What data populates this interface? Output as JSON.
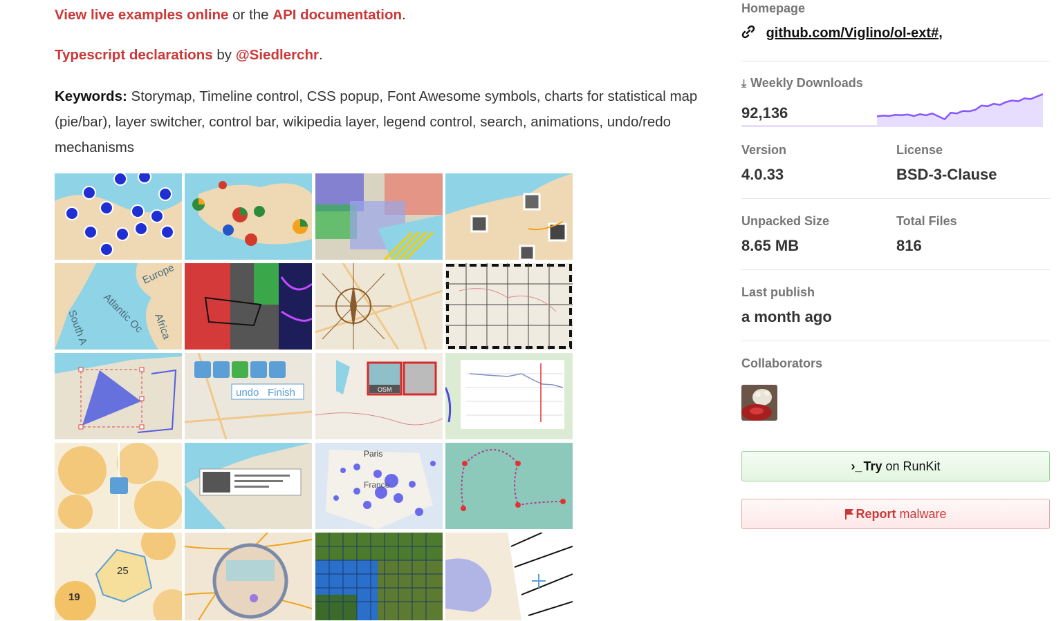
{
  "readme": {
    "live_examples_link": "View live examples online",
    "or_the_text": "or the",
    "api_docs_link": "API documentation",
    "period1": ".",
    "typescript_link": "Typescript declarations",
    "by_text": "by",
    "author_link": "@Siedlerchr",
    "period2": ".",
    "keywords_label": "Keywords:",
    "keywords_text": "Storymap, Timeline control, CSS popup, Font Awesome symbols, charts for statistical map (pie/bar), layer switcher, control bar, wikipedia layer, legend control, search, animations, undo/redo mechanisms",
    "tile_labels": {
      "europe": "Europe",
      "atlantic": "Atlantic Oc",
      "africa": "Africa",
      "south": "South A",
      "undo": "undo",
      "finish": "Finish",
      "osm": "OSM",
      "paris": "Paris",
      "france": "France",
      "cluster_25": "25",
      "cluster_19": "19"
    }
  },
  "sidebar": {
    "homepage_label": "Homepage",
    "homepage_url": "github.com/Viglino/ol-ext#,",
    "weekly_downloads_label": "Weekly Downloads",
    "weekly_downloads_value": "92,136",
    "sparkline": [
      0.3,
      0.32,
      0.31,
      0.34,
      0.33,
      0.35,
      0.31,
      0.36,
      0.33,
      0.38,
      0.3,
      0.22,
      0.4,
      0.38,
      0.45,
      0.44,
      0.48,
      0.6,
      0.58,
      0.65,
      0.62,
      0.7,
      0.74,
      0.72,
      0.8,
      0.78,
      0.85,
      0.92
    ],
    "version_label": "Version",
    "version_value": "4.0.33",
    "license_label": "License",
    "license_value": "BSD-3-Clause",
    "unpacked_size_label": "Unpacked Size",
    "unpacked_size_value": "8.65 MB",
    "total_files_label": "Total Files",
    "total_files_value": "816",
    "last_publish_label": "Last publish",
    "last_publish_value": "a month ago",
    "collaborators_label": "Collaborators",
    "runkit_button": {
      "prompt": "›_",
      "bold": "Try",
      "rest": "on RunKit"
    },
    "report_button": {
      "bold": "Report",
      "rest": "malware"
    }
  },
  "colors": {
    "link": "#cb3837",
    "sparkline_stroke": "#8956ff",
    "sparkline_fill": "#e6ddff"
  }
}
